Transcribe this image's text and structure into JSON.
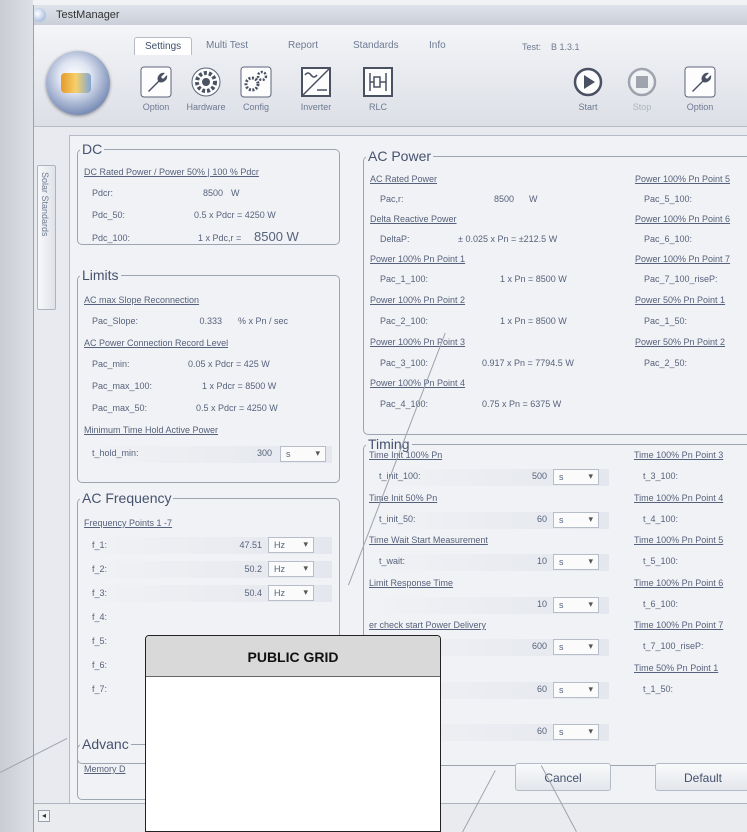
{
  "window": {
    "title": "TestManager"
  },
  "tabs": [
    "Settings",
    "Multi Test",
    "Report",
    "Standards",
    "Info"
  ],
  "test": {
    "label": "Test:",
    "value": "B 1.3.1"
  },
  "tools_left": [
    {
      "label": "Option",
      "icon": "wrench-icon"
    },
    {
      "label": "Hardware",
      "icon": "hardware-gear-icon"
    },
    {
      "label": "Config",
      "icon": "config-gears-icon"
    },
    {
      "label": "Inverter",
      "icon": "inverter-icon"
    },
    {
      "label": "RLC",
      "icon": "rlc-circuit-icon"
    }
  ],
  "tools_right": [
    {
      "label": "Start",
      "icon": "play-icon"
    },
    {
      "label": "Stop",
      "icon": "stop-icon"
    },
    {
      "label": "Option",
      "icon": "wrench-icon"
    }
  ],
  "sidebar": {
    "tab": "Solar Standards"
  },
  "dc": {
    "title": "DC",
    "link": "DC Rated Power / Power 50% | 100 % Pdcr",
    "rows": [
      {
        "label": "Pdcr:",
        "value": "8500",
        "unit": "W"
      },
      {
        "label": "Pdc_50:",
        "value": "0.5  x Pdcr = 4250 W"
      },
      {
        "label": "Pdc_100:",
        "value": "1  x Pdc,r =",
        "big": "8500 W"
      }
    ]
  },
  "limits": {
    "title": "Limits",
    "link1": "AC max Slope Reconnection",
    "slope": {
      "label": "Pac_Slope:",
      "value": "0.333",
      "unit": "% x Pn / sec"
    },
    "link2": "AC Power Connection Record Level",
    "rows": [
      {
        "label": "Pac_min:",
        "value": "0.05  x Pdcr = 425 W"
      },
      {
        "label": "Pac_max_100:",
        "value": "1  x Pdcr = 8500 W"
      },
      {
        "label": "Pac_max_50:",
        "value": "0.5  x Pdcr = 4250 W"
      }
    ],
    "link3": "Minimum Time Hold Active Power",
    "hold": {
      "label": "t_hold_min:",
      "value": "300",
      "unit": "s"
    }
  },
  "acfreq": {
    "title": "AC Frequency",
    "link": "Frequency Points 1 -7",
    "rows": [
      {
        "label": "f_1:",
        "value": "47.51",
        "unit": "Hz"
      },
      {
        "label": "f_2:",
        "value": "50.2",
        "unit": "Hz"
      },
      {
        "label": "f_3:",
        "value": "50.4",
        "unit": "Hz"
      },
      {
        "label": "f_4:"
      },
      {
        "label": "f_5:"
      },
      {
        "label": "f_6:"
      },
      {
        "label": "f_7:"
      }
    ]
  },
  "advanced": {
    "title": "Advanc",
    "link": "Memory D"
  },
  "acpower": {
    "title": "AC Power",
    "link_rated": "AC Rated Power",
    "pacr": {
      "label": "Pac,r:",
      "value": "8500",
      "unit": "W"
    },
    "link_delta": "Delta Reactive Power",
    "delta": {
      "label": "DeltaP:",
      "value": "±  0.025  x Pn = ±212.5 W"
    },
    "left_groups": [
      {
        "link": "Power 100% Pn Point 1",
        "label": "Pac_1_100:",
        "value": "1  x Pn = 8500 W"
      },
      {
        "link": "Power 100% Pn Point 2",
        "label": "Pac_2_100:",
        "value": "1  x Pn = 8500 W"
      },
      {
        "link": "Power 100% Pn Point 3",
        "label": "Pac_3_100:",
        "value": "0.917  x Pn = 7794.5 W"
      },
      {
        "link": "Power 100% Pn Point 4",
        "label": "Pac_4_100:",
        "value": "0.75  x Pn = 6375 W"
      }
    ],
    "right_groups": [
      {
        "link": "Power 100% Pn Point 5",
        "label": "Pac_5_100:"
      },
      {
        "link": "Power 100% Pn Point 6",
        "label": "Pac_6_100:"
      },
      {
        "link": "Power 100% Pn Point 7",
        "label": "Pac_7_100_riseP:"
      },
      {
        "link": "Power 50% Pn Point 1",
        "label": "Pac_1_50:"
      },
      {
        "link": "Power 50% Pn Point 2",
        "label": "Pac_2_50:"
      }
    ]
  },
  "timing": {
    "title": "Timing",
    "left_groups": [
      {
        "link": "Time Init 100% Pn",
        "label": "t_init_100:",
        "value": "500",
        "unit": "s"
      },
      {
        "link": "Time Init 50% Pn",
        "label": "t_init_50:",
        "value": "60",
        "unit": "s"
      },
      {
        "link": "Time Wait Start Measurement",
        "label": "t_wait:",
        "value": "10",
        "unit": "s"
      },
      {
        "link": "Limit Response Time",
        "label": "",
        "value": "10",
        "unit": "s"
      },
      {
        "link": "er check start Power Delivery",
        "label": "ut:",
        "value": "600",
        "unit": "s"
      },
      {
        "link": "Point 1",
        "label": "",
        "value": "60",
        "unit": "s"
      },
      {
        "link": "Point 2",
        "label": "",
        "value": "60",
        "unit": "s"
      }
    ],
    "right_groups": [
      {
        "link": "Time 100% Pn Point 3",
        "label": "t_3_100:"
      },
      {
        "link": "Time 100% Pn Point 4",
        "label": "t_4_100:"
      },
      {
        "link": "Time 100% Pn Point 5",
        "label": "t_5_100:"
      },
      {
        "link": "Time 100% Pn Point 6",
        "label": "t_6_100:"
      },
      {
        "link": "Time 100% Pn Point 7",
        "label": "t_7_100_riseP:"
      },
      {
        "link": "Time 50% Pn Point 1",
        "label": "t_1_50:"
      }
    ]
  },
  "buttons": {
    "cancel": "Cancel",
    "default": "Default"
  },
  "popup": {
    "title": "PUBLIC GRID"
  }
}
